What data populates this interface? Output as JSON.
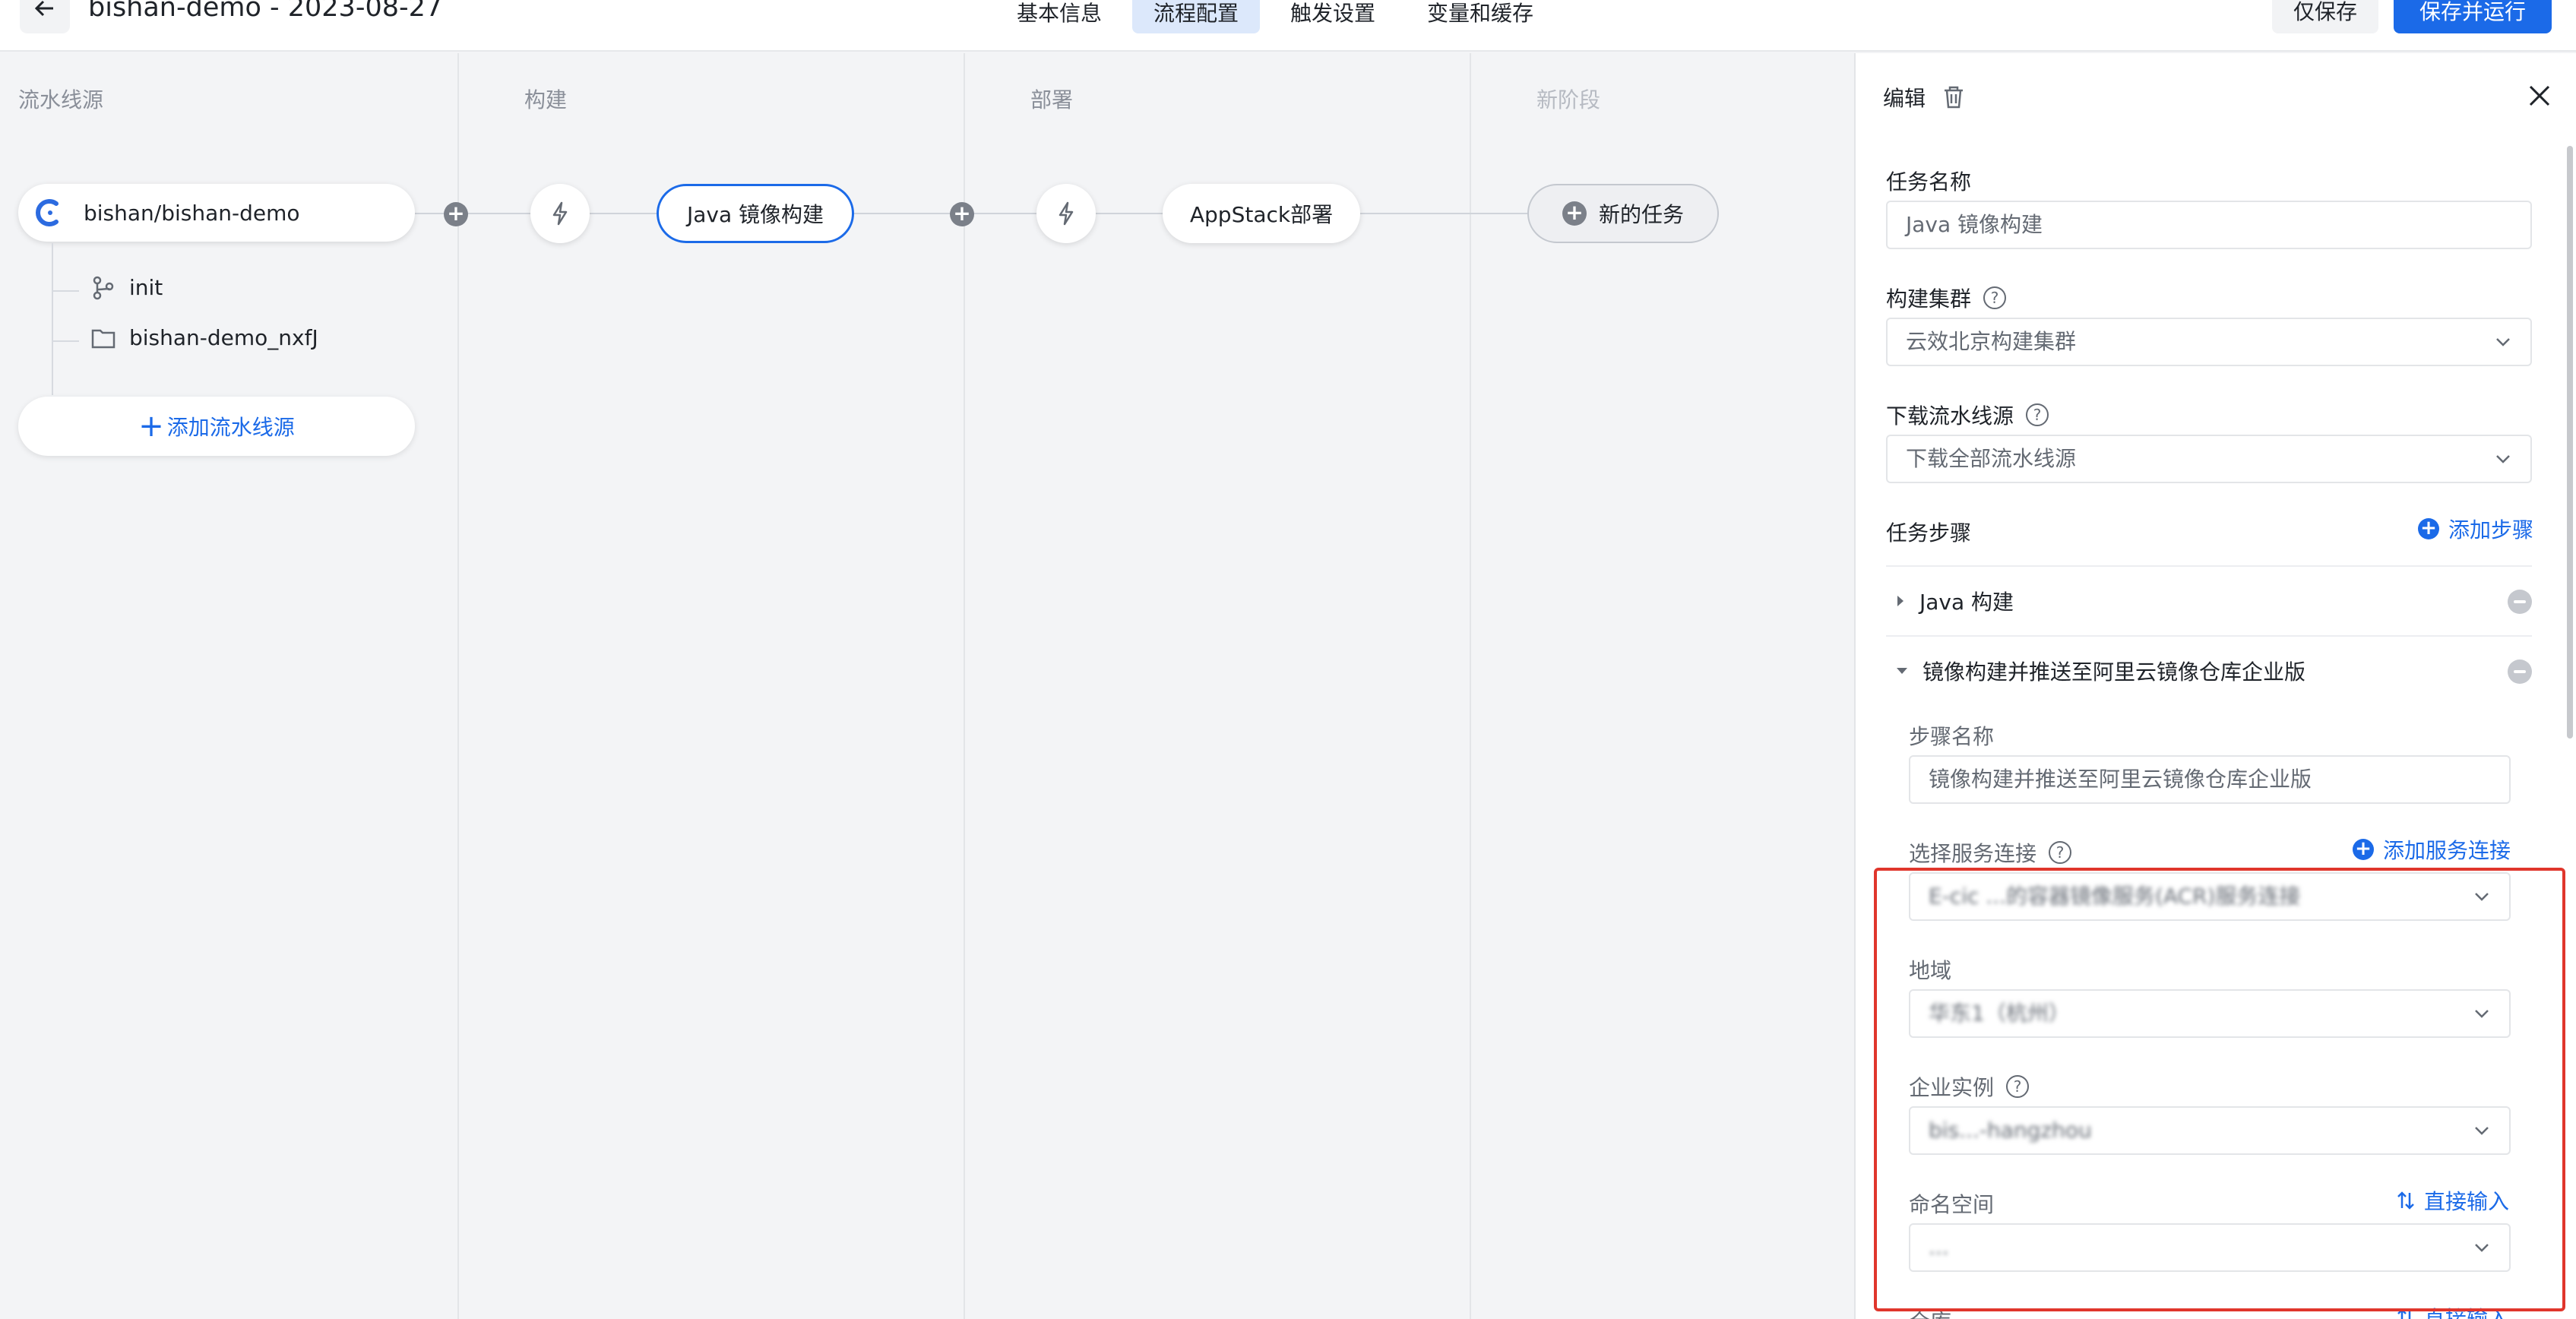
{
  "header": {
    "title": "bishan-demo - 2023-08-27",
    "tabs": [
      {
        "label": "基本信息"
      },
      {
        "label": "流程配置"
      },
      {
        "label": "触发设置"
      },
      {
        "label": "变量和缓存"
      }
    ],
    "save_label": "仅保存",
    "run_label": "保存并运行"
  },
  "pipeline": {
    "columns": [
      "流水线源",
      "构建",
      "部署",
      "新阶段"
    ],
    "source": {
      "repo": "bishan/bishan-demo",
      "branch": "init",
      "folder": "bishan-demo_nxfJ"
    },
    "add_source_label": "添加流水线源",
    "jobs": {
      "build": "Java 镜像构建",
      "deploy": "AppStack部署",
      "new_task": "新的任务"
    }
  },
  "panel": {
    "title": "编辑",
    "task_name_label": "任务名称",
    "task_name_value": "Java 镜像构建",
    "cluster_label": "构建集群",
    "cluster_value": "云效北京构建集群",
    "download_label": "下载流水线源",
    "download_value": "下载全部流水线源",
    "steps_label": "任务步骤",
    "add_step_label": "添加步骤",
    "steps": [
      {
        "name": "Java 构建"
      },
      {
        "name": "镜像构建并推送至阿里云镜像仓库企业版"
      }
    ],
    "step_name_label": "步骤名称",
    "step_name_value": "镜像构建并推送至阿里云镜像仓库企业版",
    "service_conn_label": "选择服务连接",
    "add_service_conn_label": "添加服务连接",
    "service_conn_value": "E-cic ...的容器镜像服务(ACR)服务连接",
    "region_label": "地域",
    "region_value": "华东1（杭州）",
    "instance_label": "企业实例",
    "instance_value": "bis...-hangzhou",
    "namespace_label": "命名空间",
    "direct_input_label": "直接输入",
    "namespace_value": "...",
    "repo_label": "仓库",
    "direct_input_label_2": "直接输入"
  },
  "colors": {
    "accent": "#1b6ae8",
    "active_tab_bg": "#dce8fb",
    "highlight": "#e0362c"
  }
}
